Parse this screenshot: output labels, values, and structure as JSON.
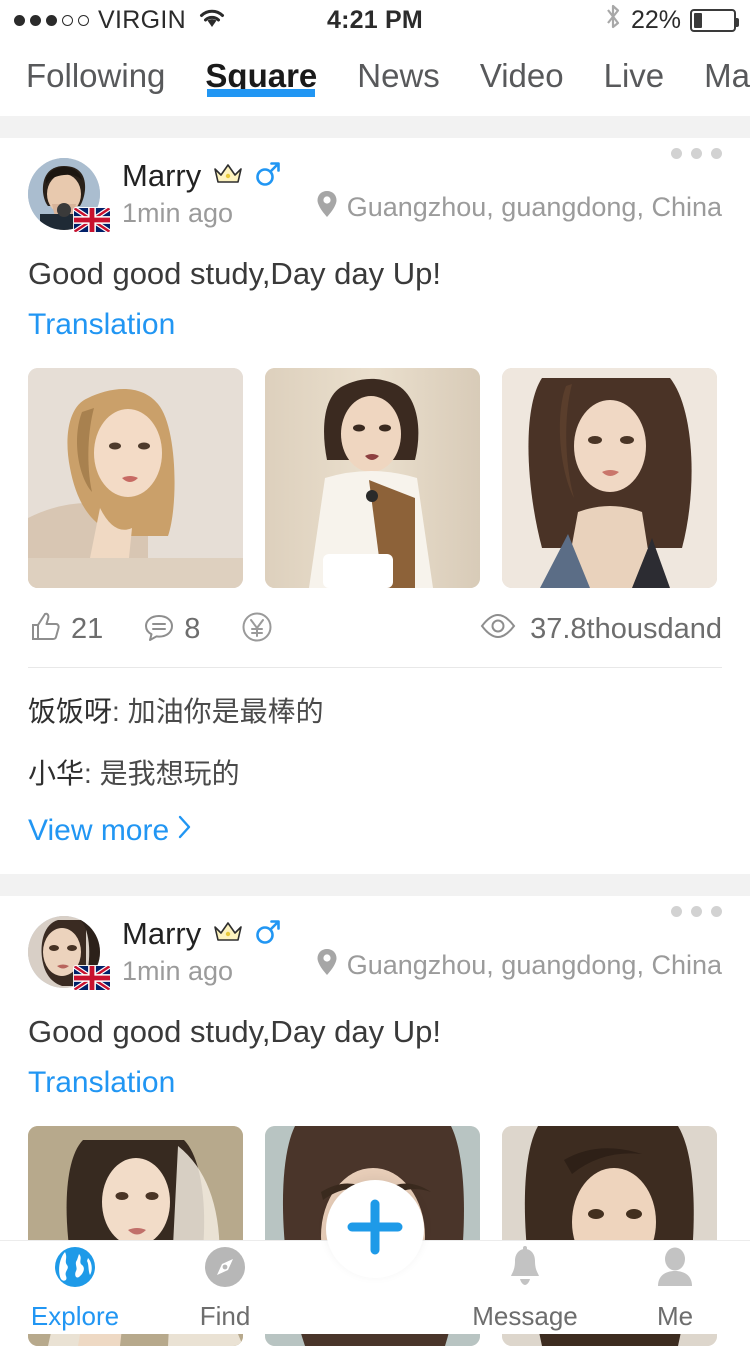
{
  "status_bar": {
    "signal_dots_filled": 3,
    "signal_dots_total": 5,
    "carrier": "VIRGIN",
    "wifi_icon": "wifi-icon",
    "time": "4:21 PM",
    "bluetooth_icon": "bluetooth-icon",
    "battery_percent": "22%",
    "battery_level": 22
  },
  "tabs": {
    "items": [
      {
        "label": "Following",
        "active": false
      },
      {
        "label": "Square",
        "active": true
      },
      {
        "label": "News",
        "active": false
      },
      {
        "label": "Video",
        "active": false
      },
      {
        "label": "Live",
        "active": false
      },
      {
        "label": "Ma",
        "active": false
      }
    ],
    "active_indicator_color": "#2196f3"
  },
  "posts": [
    {
      "username": "Marry",
      "crown_badge": "👑",
      "gender_icon": "♂",
      "flag_badge": "uk-flag-icon",
      "time": "1min ago",
      "location": "Guangzhou, guangdong, China",
      "location_icon": "location-pin-icon",
      "more_icon": "more-options-icon",
      "text": "Good good study,Day day Up!",
      "translation_label": "Translation",
      "images": [
        {
          "name": "post-image-1",
          "alt": "portrait-blonde-woman"
        },
        {
          "name": "post-image-2",
          "alt": "portrait-woman-white-blouse"
        },
        {
          "name": "post-image-3",
          "alt": "portrait-woman-denim"
        }
      ],
      "actions": {
        "like_icon": "thumbs-up-icon",
        "like_count": "21",
        "comment_icon": "comment-bubble-icon",
        "comment_count": "8",
        "gift_icon": "yen-coin-icon",
        "views_icon": "eye-icon",
        "views_count": "37.8thousdand"
      },
      "comments": [
        {
          "author": "饭饭呀",
          "text": "加油你是最棒的"
        },
        {
          "author": "小华",
          "text": "是我想玩的"
        }
      ],
      "view_more_label": "View more",
      "view_more_icon": "chevron-right-icon"
    },
    {
      "username": "Marry",
      "crown_badge": "👑",
      "gender_icon": "♂",
      "flag_badge": "uk-flag-icon",
      "time": "1min ago",
      "location": "Guangzhou, guangdong, China",
      "location_icon": "location-pin-icon",
      "more_icon": "more-options-icon",
      "text": "Good good study,Day day Up!",
      "translation_label": "Translation",
      "images": [
        {
          "name": "post-image-1",
          "alt": "portrait-bride-veil"
        },
        {
          "name": "post-image-2",
          "alt": "portrait-green-eyes"
        },
        {
          "name": "post-image-3",
          "alt": "portrait-woman-earring"
        }
      ]
    }
  ],
  "bottom_nav": {
    "items": [
      {
        "label": "Explore",
        "icon": "globe-icon",
        "active": true
      },
      {
        "label": "Find",
        "icon": "compass-icon",
        "active": false
      },
      {
        "label": "",
        "icon": "spacer",
        "active": false
      },
      {
        "label": "Message",
        "icon": "bell-icon",
        "active": false
      },
      {
        "label": "Me",
        "icon": "person-icon",
        "active": false
      }
    ],
    "fab_icon": "plus-icon",
    "fab_color": "#1e9ae8",
    "active_color": "#2196f3"
  }
}
